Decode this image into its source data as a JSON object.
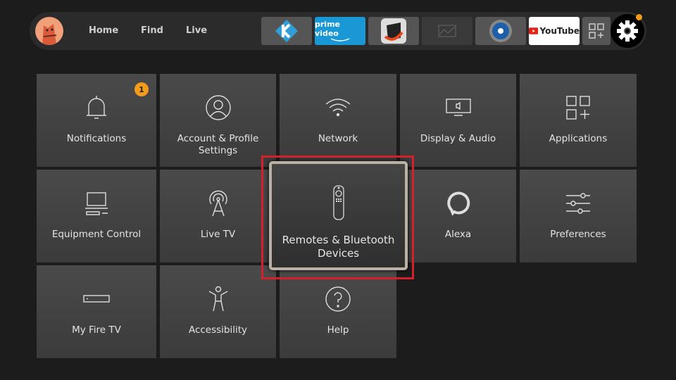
{
  "nav": {
    "items": [
      "Home",
      "Find",
      "Live"
    ]
  },
  "apps": [
    {
      "name": "kodi",
      "icon": "kodi-icon"
    },
    {
      "name": "prime video",
      "label": "prime video"
    },
    {
      "name": "downloader",
      "icon": "app-icon"
    },
    {
      "name": "placeholder",
      "icon": "image-placeholder-icon"
    },
    {
      "name": "es file explorer",
      "icon": "app-icon"
    },
    {
      "name": "youtube",
      "label": "YouTube"
    }
  ],
  "settings": {
    "notification_dot_color": "#f39b1c"
  },
  "tiles": [
    {
      "label": "Notifications",
      "badge": "1"
    },
    {
      "label": "Account & Profile Settings"
    },
    {
      "label": "Network"
    },
    {
      "label": "Display & Audio"
    },
    {
      "label": "Applications"
    },
    {
      "label": "Equipment Control"
    },
    {
      "label": "Live TV"
    },
    {
      "label": "Remotes & Bluetooth Devices",
      "focused": true
    },
    {
      "label": "Alexa"
    },
    {
      "label": "Preferences"
    },
    {
      "label": "My Fire TV"
    },
    {
      "label": "Accessibility"
    },
    {
      "label": "Help"
    }
  ],
  "colors": {
    "highlight": "#d4202a",
    "badge": "#f39b1c"
  }
}
